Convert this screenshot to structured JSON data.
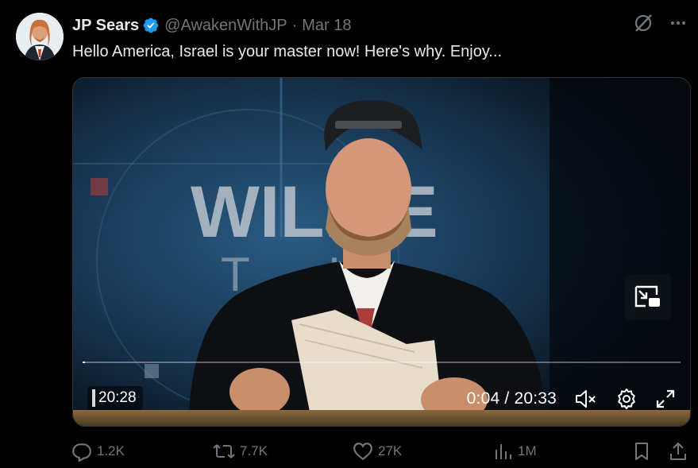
{
  "author": {
    "name": "JP Sears",
    "handle": "@AwakenWithJP",
    "separator": "·",
    "date": "Mar 18"
  },
  "tweet": {
    "text": "Hello America, Israel is your master now! Here's why. Enjoy..."
  },
  "video": {
    "background_text_line1": "WILLIE",
    "background_text_line2": "T      U",
    "remaining_time": "20:28",
    "current_time": "0:04",
    "total_time": "20:33",
    "time_display": "0:04 / 20:33",
    "progress_fraction": 0.003,
    "muted": true
  },
  "actions": {
    "replies": "1.2K",
    "reposts": "7.7K",
    "likes": "27K",
    "views": "1M"
  },
  "colors": {
    "background": "#000000",
    "text_primary": "#e7e9ea",
    "text_secondary": "#71767b",
    "verified_blue": "#1d9bf0"
  },
  "icons": [
    "grok-icon",
    "more-icon",
    "verified-badge-icon",
    "pip-icon",
    "mute-icon",
    "settings-icon",
    "fullscreen-icon",
    "reply-icon",
    "repost-icon",
    "like-icon",
    "views-icon",
    "bookmark-icon",
    "share-icon"
  ]
}
